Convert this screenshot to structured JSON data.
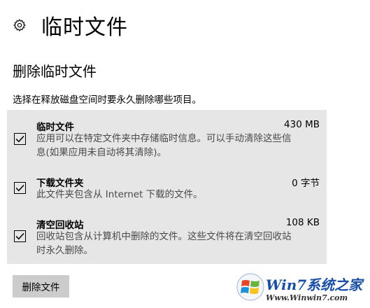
{
  "header": {
    "title": "临时文件",
    "icon": "gear-icon"
  },
  "section": {
    "title": "删除临时文件",
    "description": "选择在释放磁盘空间时要永久删除哪些项目。"
  },
  "items": [
    {
      "name": "临时文件",
      "size": "430 MB",
      "checked": true,
      "desc1": "应用可以在特定文件夹中存储临时信息。可以手动清除这些信",
      "desc2": "息(如果应用未自动将其清除)。"
    },
    {
      "name": "下载文件夹",
      "size": "0 字节",
      "checked": true,
      "desc1": "此文件夹包含从 Internet 下载的文件。"
    },
    {
      "name": "清空回收站",
      "size": "108 KB",
      "checked": true,
      "desc1": "回收站包含从计算机中删除的文件。这些文件将在清空回收站",
      "desc2": "时永久删除。"
    }
  ],
  "button": {
    "label": "删除文件"
  },
  "watermark": {
    "line1": "Win7系统之家",
    "line2": "Www.Winwin7.com"
  },
  "colors": {
    "panel": "#e6e6e6",
    "button": "#cccccc",
    "watermark": "#1a4fa3"
  }
}
